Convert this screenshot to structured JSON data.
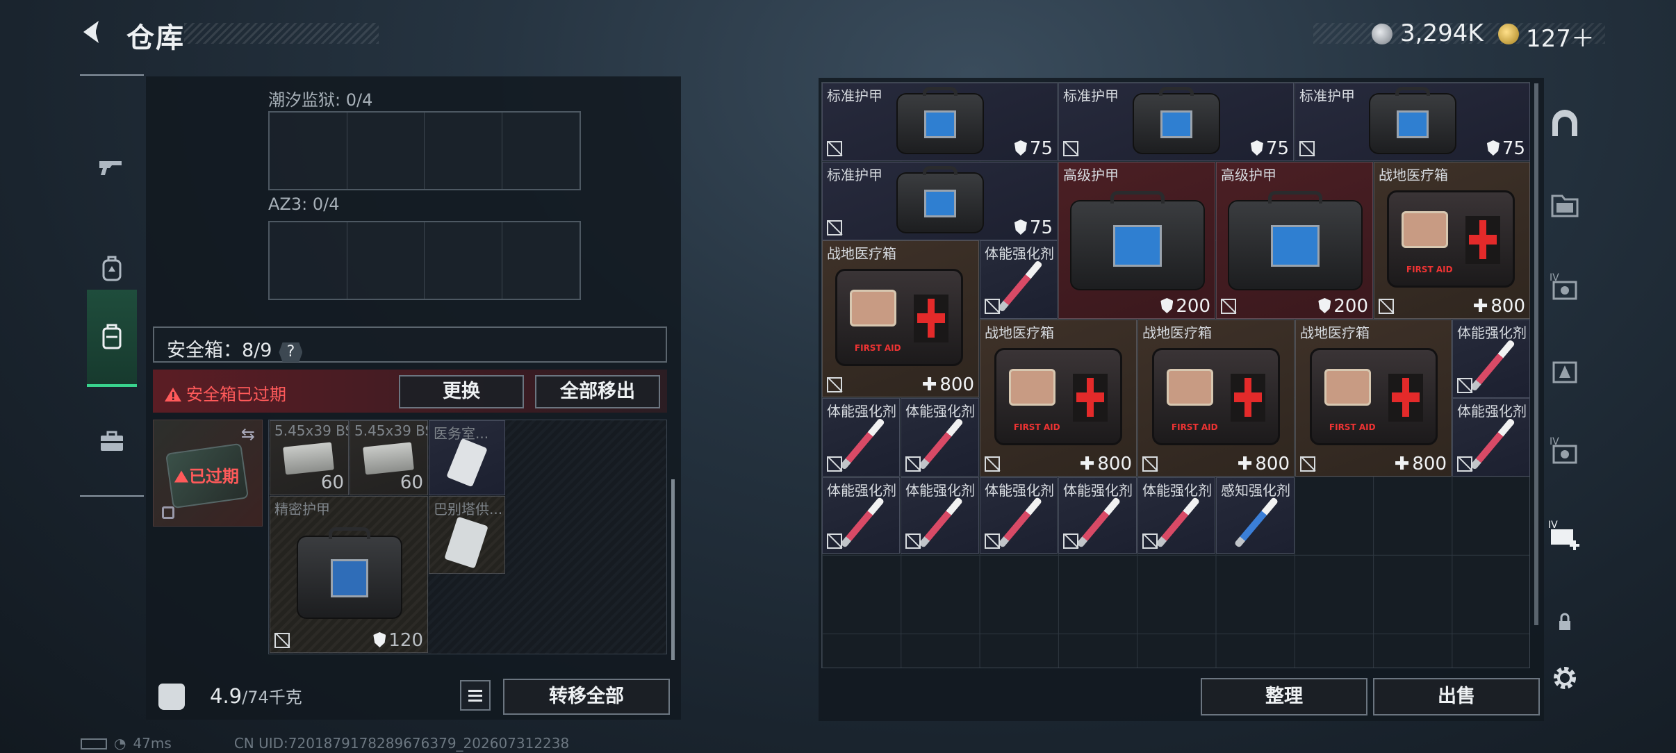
{
  "header": {
    "title": "仓库",
    "back_icon": "back-arrow-icon"
  },
  "currency": [
    {
      "icon": "silver-coin-icon",
      "value": "3,294K"
    },
    {
      "icon": "gold-coin-icon",
      "value": "127＋"
    }
  ],
  "left_nav": [
    {
      "name": "weapons",
      "icon": "pistol-icon"
    },
    {
      "name": "backpack",
      "icon": "backpack-icon"
    },
    {
      "name": "container",
      "icon": "container-icon",
      "active": true
    },
    {
      "name": "toolbox",
      "icon": "briefcase-icon"
    }
  ],
  "left_panel": {
    "sections": [
      {
        "label": "潮汐监狱: 0/4"
      },
      {
        "label": "AZ3: 0/4"
      }
    ],
    "safebox": {
      "title": "安全箱：8/9",
      "help": "?",
      "expired_banner": "安全箱已过期",
      "thumb_label": "已过期",
      "swap_label": "更换",
      "moveall_label": "全部移出"
    },
    "items": [
      {
        "label": "5.45x39 BS",
        "count": "60"
      },
      {
        "label": "5.45x39 BS",
        "count": "60"
      },
      {
        "label": "医务室..."
      },
      {
        "label": "精密护甲",
        "value": "120"
      },
      {
        "label": "巴别塔供..."
      }
    ],
    "weight": {
      "current": "4.9",
      "max": "/74千克"
    },
    "transfer_label": "转移全部"
  },
  "right_panel": {
    "items": [
      {
        "label": "标准护甲",
        "value": "75"
      },
      {
        "label": "标准护甲",
        "value": "75"
      },
      {
        "label": "标准护甲",
        "value": "75"
      },
      {
        "label": "标准护甲",
        "value": "75"
      },
      {
        "label": "高级护甲",
        "value": "200"
      },
      {
        "label": "高级护甲",
        "value": "200"
      },
      {
        "label": "战地医疗箱",
        "value": "800"
      },
      {
        "label": "战地医疗箱",
        "value": "800"
      },
      {
        "label": "体能强化剂"
      },
      {
        "label": "战地医疗箱",
        "value": "800"
      },
      {
        "label": "战地医疗箱",
        "value": "800"
      },
      {
        "label": "战地医疗箱",
        "value": "800"
      },
      {
        "label": "体能强化剂"
      },
      {
        "label": "体能强化剂"
      },
      {
        "label": "体能强化剂"
      },
      {
        "label": "体能强化剂"
      },
      {
        "label": "体能强化剂"
      },
      {
        "label": "体能强化剂"
      },
      {
        "label": "体能强化剂"
      },
      {
        "label": "体能强化剂"
      },
      {
        "label": "体能强化剂"
      },
      {
        "label": "感知强化剂"
      }
    ],
    "sort_label": "整理",
    "sell_label": "出售"
  },
  "right_bar": [
    "home-icon",
    "folder-icon",
    "storage-iv-icon",
    "storage-a-icon",
    "storage-iv-2-icon",
    "add-storage-icon",
    "lock-icon",
    "settings-icon"
  ],
  "status": {
    "ping": "47ms",
    "uid": "CN UID:7201879178289676379_202607312238"
  },
  "colors": {
    "active_tab": "#39d38d",
    "expired": "#ff5a5a",
    "armor_hi": "#4b1f24",
    "medkit": "#3e3128"
  }
}
